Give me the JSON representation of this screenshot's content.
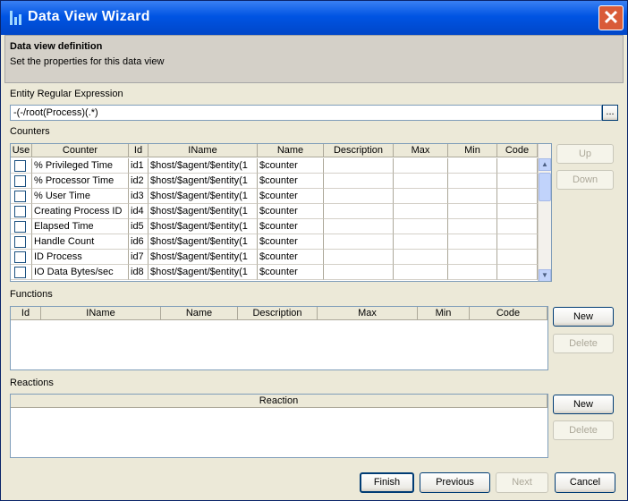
{
  "window": {
    "title": "Data View Wizard",
    "close_glyph": "✕"
  },
  "header": {
    "title": "Data view definition",
    "subtitle": "Set the properties for this data view"
  },
  "regex": {
    "label": "Entity Regular Expression",
    "value": "-(-/root(Process)(.*)",
    "browse_label": "..."
  },
  "counters": {
    "label": "Counters",
    "columns": [
      "Use",
      "Counter",
      "Id",
      "IName",
      "Name",
      "Description",
      "Max",
      "Min",
      "Code"
    ],
    "rows": [
      {
        "use": false,
        "counter": "% Privileged Time",
        "id": "id1",
        "iname": "$host/$agent/$entity(1",
        "name": "$counter"
      },
      {
        "use": false,
        "counter": "% Processor Time",
        "id": "id2",
        "iname": "$host/$agent/$entity(1",
        "name": "$counter"
      },
      {
        "use": false,
        "counter": "% User Time",
        "id": "id3",
        "iname": "$host/$agent/$entity(1",
        "name": "$counter"
      },
      {
        "use": false,
        "counter": "Creating Process ID",
        "id": "id4",
        "iname": "$host/$agent/$entity(1",
        "name": "$counter"
      },
      {
        "use": false,
        "counter": "Elapsed Time",
        "id": "id5",
        "iname": "$host/$agent/$entity(1",
        "name": "$counter"
      },
      {
        "use": false,
        "counter": "Handle Count",
        "id": "id6",
        "iname": "$host/$agent/$entity(1",
        "name": "$counter"
      },
      {
        "use": false,
        "counter": "ID Process",
        "id": "id7",
        "iname": "$host/$agent/$entity(1",
        "name": "$counter"
      },
      {
        "use": false,
        "counter": "IO Data Bytes/sec",
        "id": "id8",
        "iname": "$host/$agent/$entity(1",
        "name": "$counter"
      }
    ],
    "up_label": "Up",
    "down_label": "Down"
  },
  "functions": {
    "label": "Functions",
    "columns": [
      "Id",
      "IName",
      "Name",
      "Description",
      "Max",
      "Min",
      "Code"
    ],
    "new_label": "New",
    "delete_label": "Delete"
  },
  "reactions": {
    "label": "Reactions",
    "column": "Reaction",
    "new_label": "New",
    "delete_label": "Delete"
  },
  "footer": {
    "finish": "Finish",
    "previous": "Previous",
    "next": "Next",
    "cancel": "Cancel"
  },
  "colors": {
    "title_bar": "#0054e3",
    "close_button": "#d95b38",
    "window_bg": "#ece9d8"
  }
}
